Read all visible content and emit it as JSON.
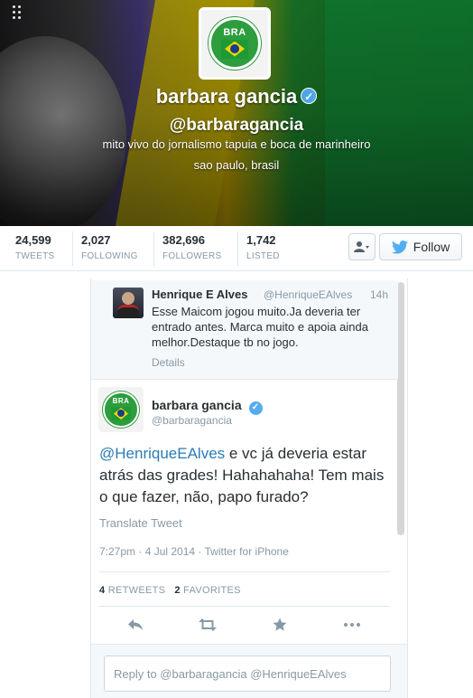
{
  "profile": {
    "name": "barbara gancia",
    "handle": "@barbaragancia",
    "bio": "mito vivo do jornalismo tapuia e boca de marinheiro",
    "location": "sao paulo, brasil",
    "avatar_text": "BRA",
    "verified_icon": "verified-check-icon"
  },
  "stats": [
    {
      "value": "24,599",
      "label": "TWEETS"
    },
    {
      "value": "2,027",
      "label": "FOLLOWING"
    },
    {
      "value": "382,696",
      "label": "FOLLOWERS"
    },
    {
      "value": "1,742",
      "label": "LISTED"
    }
  ],
  "actions": {
    "follow_label": "Follow",
    "user_menu_icon": "user-dropdown-icon"
  },
  "previous_tweet": {
    "name": "Henrique E Alves",
    "handle": "@HenriqueEAlves",
    "time": "14h",
    "text": "Esse Maicom jogou muito.Ja deveria ter entrado antes. Marca muito e apoia ainda melhor.Destaque tb no jogo.",
    "details": "Details"
  },
  "tweet": {
    "name": "barbara gancia",
    "handle": "@barbaragancia",
    "avatar_text": "BRA",
    "mention": "@HenriqueEAlves",
    "text": " e vc já deveria estar atrás das grades! Hahahahaha! Tem mais o que fazer, não, papo furado?",
    "translate": "Translate Tweet",
    "meta": "7:27pm · 4 Jul 2014 · Twitter for iPhone",
    "retweets_count": "4",
    "retweets_label": "RETWEETS",
    "favorites_count": "2",
    "favorites_label": "FAVORITES"
  },
  "reply": {
    "placeholder": "Reply to @barbaragancia @HenriqueEAlves"
  },
  "colors": {
    "link": "#2b7bb9",
    "verified": "#55acee",
    "muted": "#8899a6"
  }
}
